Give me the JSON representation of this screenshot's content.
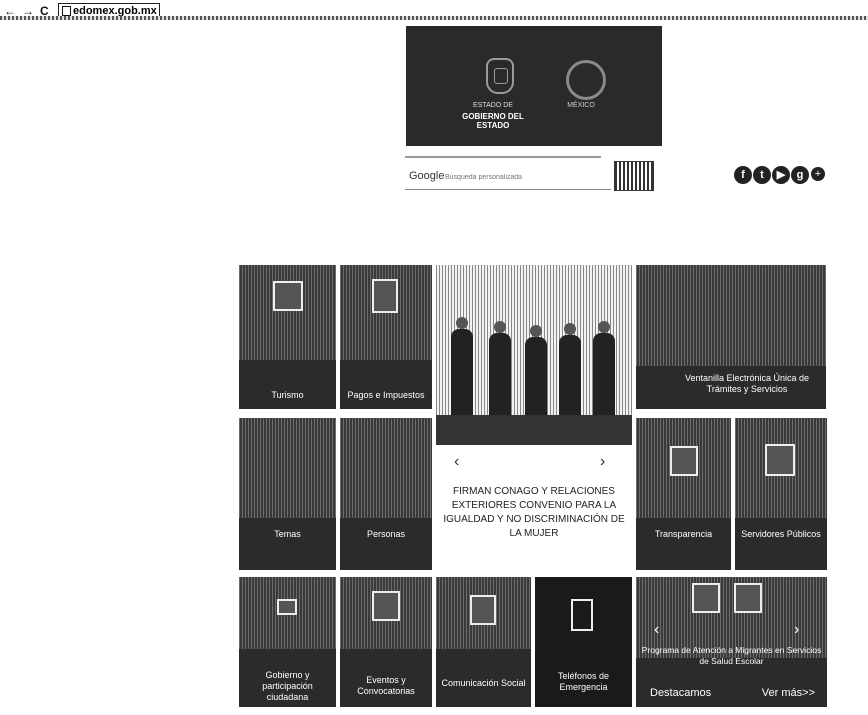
{
  "browser": {
    "back": "←",
    "forward": "→",
    "reload": "C",
    "url": "edomex.gob.mx"
  },
  "banner": {
    "line1": "ESTADO DE",
    "line2": "GOBIERNO DEL ESTADO",
    "line3": "MÉXICO"
  },
  "search": {
    "brand": "Google",
    "placeholder": "Búsqueda personalizada"
  },
  "social": [
    "f",
    "t",
    "▶",
    "g",
    "+"
  ],
  "tiles": {
    "turismo": "Turismo",
    "pagos": "Pagos e Impuestos",
    "ventanilla": "Ventanilla Electrónica Única de Trámites y Servicios",
    "temas": "Temas",
    "personas": "Personas",
    "transparencia": "Transparencia",
    "servidores": "Servidores Públicos",
    "gobierno": "Gobierno y participación ciudadana",
    "eventos": "Eventos y Convocatorias",
    "comunicacion": "Comunicación Social",
    "telefonos": "Teléfonos de Emergencia",
    "programa": "Programa de Atención a Migrantes en Servicios de Salud Escolar"
  },
  "carousel": {
    "caption": "FIRMAN CONAGO Y RELACIONES EXTERIORES CONVENIO PARA LA IGUALDAD Y NO DISCRIMINACIÓN DE LA MUJER",
    "prev": "‹",
    "next": "›"
  },
  "footer_bar": {
    "destacamos": "Destacamos",
    "ver_mas": "Ver más>>"
  },
  "colors": {
    "tile": "#2b2b2b",
    "tile_text": "#ffffff",
    "banner": "#2a2a2a"
  }
}
